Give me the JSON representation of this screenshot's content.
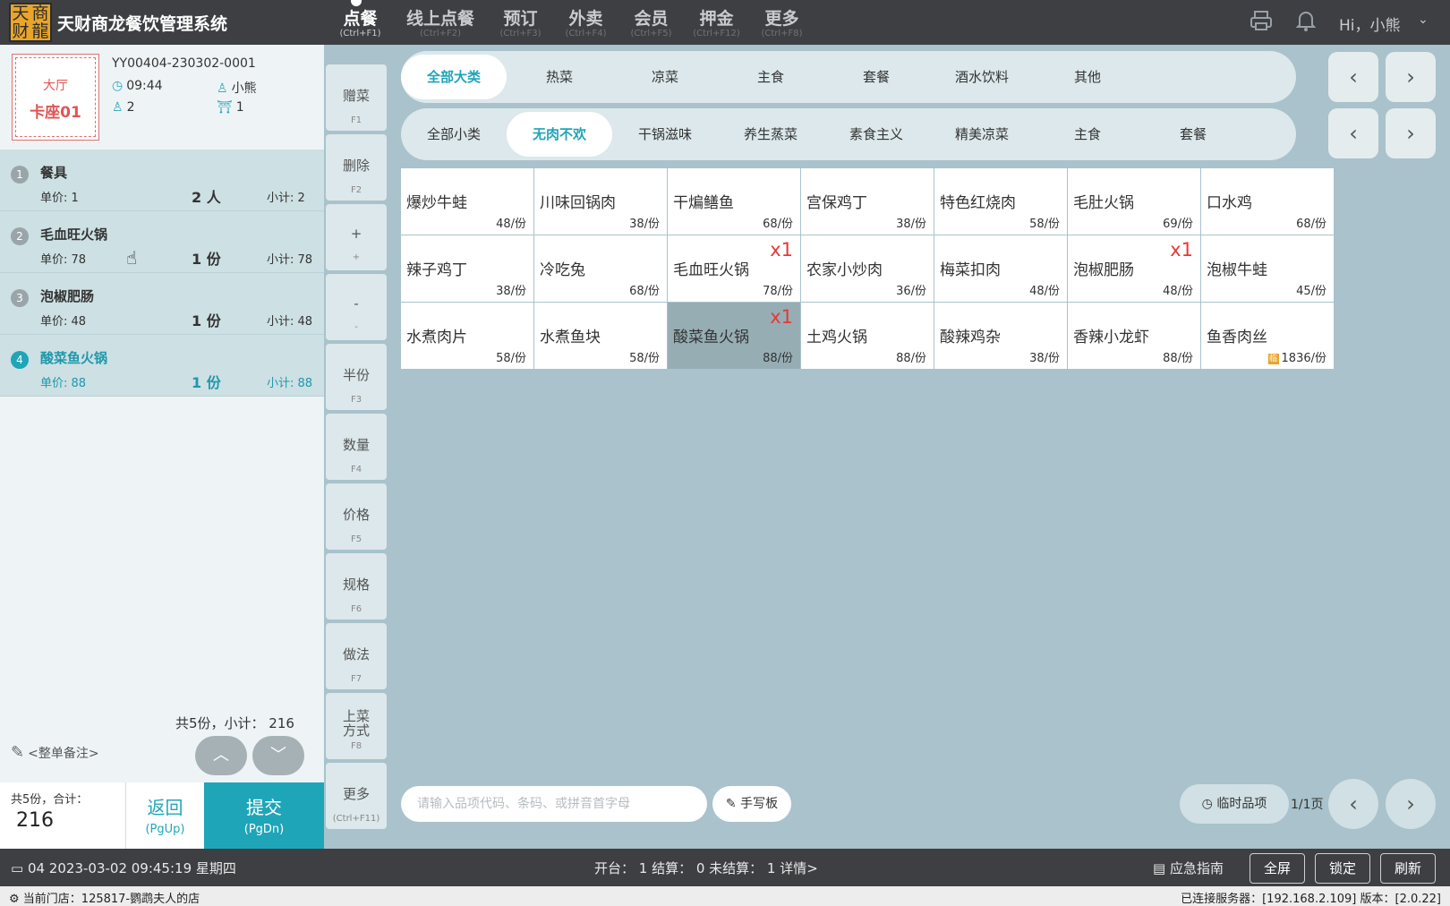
{
  "app": {
    "logo_chars": [
      "天",
      "商",
      "财",
      "龍"
    ],
    "title": "天财商龙餐饮管理系统",
    "greeting": "Hi，小熊",
    "chevron": "⌄"
  },
  "nav": [
    {
      "label": "点餐",
      "shortcut": "(Ctrl+F1)",
      "active": true
    },
    {
      "label": "线上点餐",
      "shortcut": "(Ctrl+F2)",
      "active": false
    },
    {
      "label": "预订",
      "shortcut": "(Ctrl+F3)",
      "active": false
    },
    {
      "label": "外卖",
      "shortcut": "(Ctrl+F4)",
      "active": false
    },
    {
      "label": "会员",
      "shortcut": "(Ctrl+F5)",
      "active": false
    },
    {
      "label": "押金",
      "shortcut": "(Ctrl+F12)",
      "active": false
    },
    {
      "label": "更多",
      "shortcut": "(Ctrl+F8)",
      "active": false
    }
  ],
  "icons": {
    "printer": "printer-icon",
    "bell": "bell-icon",
    "clock": "◷",
    "user": "♙",
    "guests": "♙",
    "seat": "⛩"
  },
  "table": {
    "area": "大厅",
    "name": "卡座01",
    "order_no": "YY00404-230302-0001",
    "time": "09:44",
    "waiter": "小熊",
    "guests": "2",
    "seats": "1"
  },
  "order_items": [
    {
      "num": "1",
      "name": "餐具",
      "price": "单价:  1",
      "qty": "2 人",
      "subtotal": "小计:  2"
    },
    {
      "num": "2",
      "name": "毛血旺火锅",
      "price": "单价:  78",
      "qty": "1 份",
      "subtotal": "小计:  78"
    },
    {
      "num": "3",
      "name": "泡椒肥肠",
      "price": "单价:  48",
      "qty": "1 份",
      "subtotal": "小计:  48"
    },
    {
      "num": "4",
      "name": "酸菜鱼火锅",
      "price": "单价:  88",
      "qty": "1 份",
      "subtotal": "小计:  88"
    }
  ],
  "order_summary": {
    "sum_line": "共5份，小计： 216",
    "remark": "<整单备注>",
    "up": "︿",
    "down": "﹀",
    "total_label": "共5份，合计：",
    "total_value": "216",
    "back_label": "返回",
    "back_shortcut": "(PgUp)",
    "submit_label": "提交",
    "submit_shortcut": "(PgDn)"
  },
  "actions": [
    {
      "label": "赠菜",
      "shortcut": "F1"
    },
    {
      "label": "删除",
      "shortcut": "F2"
    },
    {
      "label": "+",
      "shortcut": "+"
    },
    {
      "label": "-",
      "shortcut": "-"
    },
    {
      "label": "半份",
      "shortcut": "F3"
    },
    {
      "label": "数量",
      "shortcut": "F4"
    },
    {
      "label": "价格",
      "shortcut": "F5"
    },
    {
      "label": "规格",
      "shortcut": "F6"
    },
    {
      "label": "做法",
      "shortcut": "F7"
    },
    {
      "label": "上菜\n方式",
      "shortcut": "F8"
    },
    {
      "label": "更多",
      "shortcut": "(Ctrl+F11)"
    }
  ],
  "categories_main": [
    "全部大类",
    "热菜",
    "凉菜",
    "主食",
    "套餐",
    "酒水饮料",
    "其他"
  ],
  "categories_sub": [
    "全部小类",
    "无肉不欢",
    "干锅滋味",
    "养生蒸菜",
    "素食主义",
    "精美凉菜",
    "主食",
    "套餐"
  ],
  "arrows": {
    "prev": "‹",
    "next": "›"
  },
  "dishes": [
    {
      "name": "爆炒牛蛙",
      "price": "48/份",
      "badge": "",
      "selected": false,
      "stock": ""
    },
    {
      "name": "川味回锅肉",
      "price": "38/份",
      "badge": "",
      "selected": false,
      "stock": ""
    },
    {
      "name": "干煸鳝鱼",
      "price": "68/份",
      "badge": "",
      "selected": false,
      "stock": ""
    },
    {
      "name": "宫保鸡丁",
      "price": "38/份",
      "badge": "",
      "selected": false,
      "stock": ""
    },
    {
      "name": "特色红烧肉",
      "price": "58/份",
      "badge": "",
      "selected": false,
      "stock": ""
    },
    {
      "name": "毛肚火锅",
      "price": "69/份",
      "badge": "",
      "selected": false,
      "stock": ""
    },
    {
      "name": "口水鸡",
      "price": "68/份",
      "badge": "",
      "selected": false,
      "stock": ""
    },
    {
      "name": "辣子鸡丁",
      "price": "38/份",
      "badge": "",
      "selected": false,
      "stock": ""
    },
    {
      "name": "冷吃兔",
      "price": "68/份",
      "badge": "",
      "selected": false,
      "stock": ""
    },
    {
      "name": "毛血旺火锅",
      "price": "78/份",
      "badge": "x1",
      "selected": false,
      "stock": ""
    },
    {
      "name": "农家小炒肉",
      "price": "36/份",
      "badge": "",
      "selected": false,
      "stock": ""
    },
    {
      "name": "梅菜扣肉",
      "price": "48/份",
      "badge": "",
      "selected": false,
      "stock": ""
    },
    {
      "name": "泡椒肥肠",
      "price": "48/份",
      "badge": "x1",
      "selected": false,
      "stock": ""
    },
    {
      "name": "泡椒牛蛙",
      "price": "45/份",
      "badge": "",
      "selected": false,
      "stock": ""
    },
    {
      "name": "水煮肉片",
      "price": "58/份",
      "badge": "",
      "selected": false,
      "stock": ""
    },
    {
      "name": "水煮鱼块",
      "price": "58/份",
      "badge": "",
      "selected": false,
      "stock": ""
    },
    {
      "name": "酸菜鱼火锅",
      "price": "88/份",
      "badge": "x1",
      "selected": true,
      "stock": ""
    },
    {
      "name": "土鸡火锅",
      "price": "88/份",
      "badge": "",
      "selected": false,
      "stock": ""
    },
    {
      "name": "酸辣鸡杂",
      "price": "38/份",
      "badge": "",
      "selected": false,
      "stock": ""
    },
    {
      "name": "香辣小龙虾",
      "price": "88/份",
      "badge": "",
      "selected": false,
      "stock": ""
    },
    {
      "name": "鱼香肉丝",
      "price": "1836/份",
      "badge": "",
      "selected": false,
      "stock": "临"
    }
  ],
  "bottom": {
    "search_placeholder": "请输入品项代码、条码、或拼音首字母",
    "handwriting": "手写板",
    "temp_item": "临时品项",
    "page": "1/1页"
  },
  "status": {
    "datetime": "04 2023-03-02 09:45:19 星期四",
    "counts": "开台： 1    结算： 0    未结算： 1    详情>",
    "guide": "应急指南",
    "fullscreen": "全屏",
    "lock": "锁定",
    "refresh": "刷新"
  },
  "footer": {
    "store": "当前门店：125817-鹦鹉夫人的店",
    "server": "已连接服务器：[192.168.2.109] 版本：[2.0.22]"
  },
  "colors": {
    "accent": "#1fa5b8",
    "badge": "#e53935",
    "topbar": "#3d3f43",
    "background": "#a9c2cb"
  }
}
